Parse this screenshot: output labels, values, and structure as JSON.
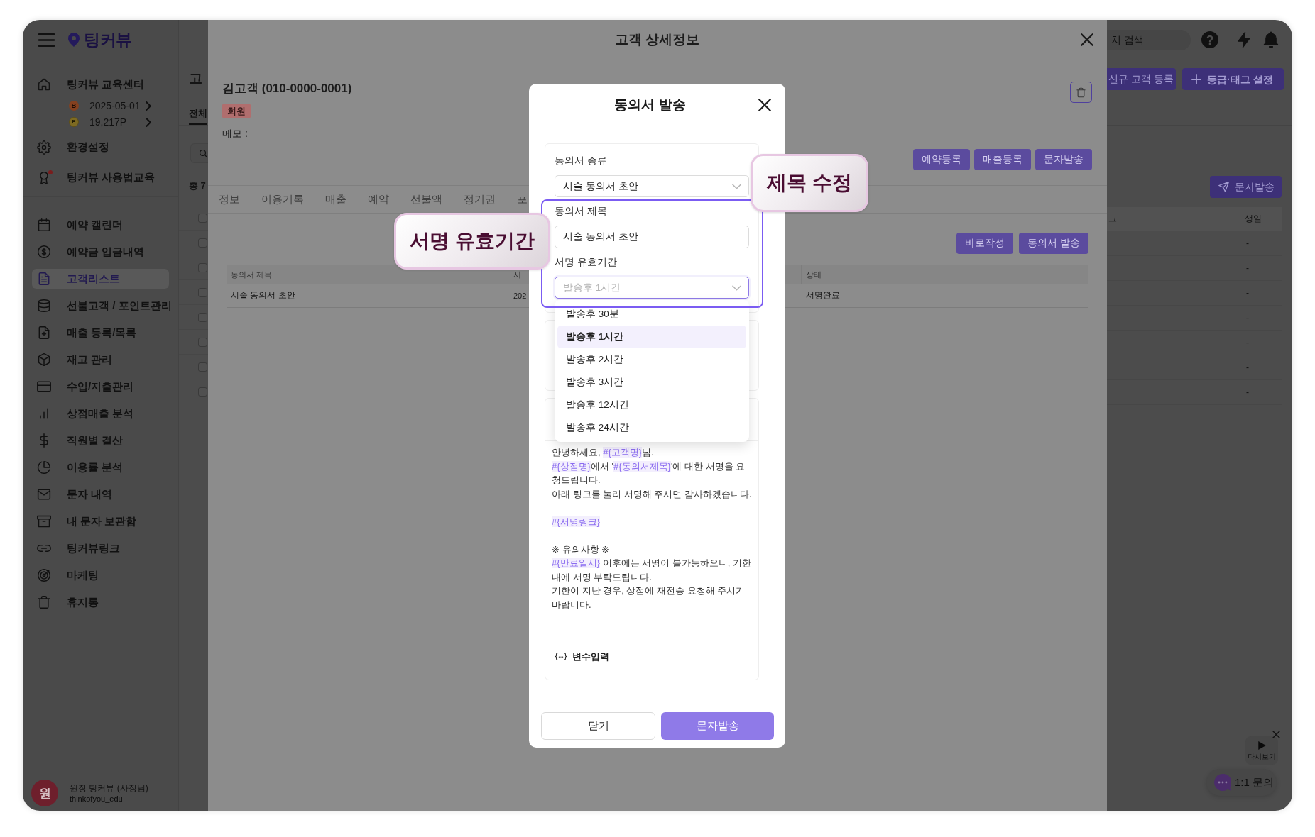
{
  "sidebar": {
    "logo": "팅커뷰",
    "store": {
      "name": "팅커뷰 교육센터",
      "grade": "B",
      "date": "2025-05-01",
      "coin": "P",
      "points": "19,217P"
    },
    "top_items": [
      {
        "label": "환경설정",
        "alert": false
      },
      {
        "label": "팅커뷰 사용법교육",
        "alert": true
      }
    ],
    "nav": [
      {
        "label": "예약 캘린더",
        "selected": false
      },
      {
        "label": "예약금 입금내역",
        "selected": false
      },
      {
        "label": "고객리스트",
        "selected": true
      },
      {
        "label": "선불고객 / 포인트관리",
        "selected": false
      },
      {
        "label": "매출 등록/목록",
        "selected": false
      },
      {
        "label": "재고 관리",
        "selected": false
      },
      {
        "label": "수입/지출관리",
        "selected": false
      },
      {
        "label": "상점매출 분석",
        "selected": false
      },
      {
        "label": "직원별 결산",
        "selected": false
      },
      {
        "label": "이용률 분석",
        "selected": false
      },
      {
        "label": "문자 내역",
        "selected": false
      },
      {
        "label": "내 문자 보관함",
        "selected": false
      },
      {
        "label": "팅커뷰링크",
        "selected": false
      },
      {
        "label": "마케팅",
        "selected": false
      },
      {
        "label": "휴지통",
        "selected": false
      }
    ],
    "user": {
      "avatar": "원",
      "name": "원장 팅커뷰 (사장님)",
      "id": "thinkofyou_edu"
    }
  },
  "top_bar": {
    "search_placeholder": "처 검색"
  },
  "customer_list": {
    "title": "고",
    "tabs": [
      {
        "label": "전체",
        "selected": true
      }
    ],
    "total": "총 7",
    "buttons": [
      "신규 고객 등록",
      "등급·태그 설정"
    ],
    "send_button": "문자발송",
    "columns": [
      "그",
      "생일"
    ],
    "header_checked": false,
    "rows": [
      {
        "checked": false,
        "birthday": "-"
      },
      {
        "checked": false,
        "birthday": "-"
      },
      {
        "checked": false,
        "birthday": "-"
      },
      {
        "checked": false,
        "birthday": "-"
      },
      {
        "checked": false,
        "birthday": "-"
      },
      {
        "checked": false,
        "birthday": "-"
      },
      {
        "checked": false,
        "birthday": "-"
      }
    ]
  },
  "customer_detail": {
    "title": "고객 상세정보",
    "name": "김고객 (010-0000-0001)",
    "badge": "회원",
    "memo": "메모 :",
    "actions": [
      "예약등록",
      "매출등록",
      "문자발송"
    ],
    "tabs": [
      {
        "label": "정보",
        "selected": false
      },
      {
        "label": "이용기록",
        "selected": false
      },
      {
        "label": "매출",
        "selected": false
      },
      {
        "label": "예약",
        "selected": false
      },
      {
        "label": "선불액",
        "selected": false
      },
      {
        "label": "정기권",
        "selected": false
      },
      {
        "label": "포",
        "selected": false
      }
    ],
    "consent_actions": [
      "바로작성",
      "동의서 발송"
    ],
    "consent_table": {
      "columns": [
        "동의서 제목",
        "시",
        "상태"
      ],
      "rows": [
        [
          "시술 동의서 초안",
          "202",
          "서명완료"
        ]
      ]
    }
  },
  "consent_dialog": {
    "title": "동의서 발송",
    "fields": [
      {
        "kind": "select",
        "label": "동의서 종류",
        "value": "시술 동의서 초안",
        "open": false
      },
      {
        "kind": "input",
        "label": "동의서 제목",
        "value": "시술 동의서 초안"
      },
      {
        "kind": "select",
        "label": "서명 유효기간",
        "value": "발송후 1시간",
        "open": true,
        "options": [
          {
            "label": "발송후 30분",
            "selected": false
          },
          {
            "label": "발송후 1시간",
            "selected": true
          },
          {
            "label": "발송후 2시간",
            "selected": false
          },
          {
            "label": "발송후 3시간",
            "selected": false
          },
          {
            "label": "발송후 12시간",
            "selected": false
          },
          {
            "label": "발송후 24시간",
            "selected": false
          }
        ]
      }
    ],
    "message": {
      "paragraphs": [
        {
          "lines": [
            [
              {
                "kind": "text",
                "text": "안녕하세요, "
              },
              {
                "kind": "variable",
                "text": "#{고객명}"
              },
              {
                "kind": "text",
                "text": "님."
              }
            ],
            [
              {
                "kind": "variable",
                "text": "#{상점명}"
              },
              {
                "kind": "text",
                "text": "에서 '"
              },
              {
                "kind": "variable",
                "text": "#{동의서제목}"
              },
              {
                "kind": "text",
                "text": "'에 대한 서명을 요청드립니다."
              }
            ],
            [
              {
                "kind": "text",
                "text": "아래 링크를 눌러 서명해 주시면 감사하겠습니다."
              }
            ]
          ]
        },
        {
          "lines": [
            [
              {
                "kind": "variable",
                "text": "#{서명링크}"
              }
            ]
          ]
        },
        {
          "lines": [
            [
              {
                "kind": "text",
                "text": "※ 유의사항 ※"
              }
            ],
            [
              {
                "kind": "variable",
                "text": "#{만료일시}"
              },
              {
                "kind": "text",
                "text": " 이후에는 서명이 불가능하오니, 기한 내에 서명 부탁드립니다."
              }
            ],
            [
              {
                "kind": "text",
                "text": "기한이 지난 경우, 상점에 재전송 요청해 주시기 바랍니다."
              }
            ]
          ]
        }
      ]
    },
    "variable_button": "변수입력",
    "buttons": [
      {
        "label": "닫기",
        "kind": "secondary"
      },
      {
        "label": "문자발송",
        "kind": "primary"
      }
    ]
  },
  "annotations": [
    "제목 수정",
    "서명 유효기간"
  ],
  "widgets": {
    "replay": "다시보기",
    "chat": "1:1 문의"
  }
}
